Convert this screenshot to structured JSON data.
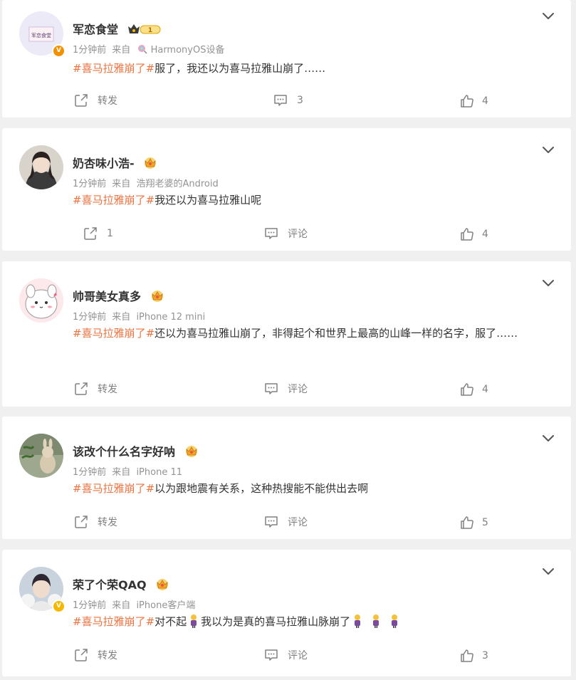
{
  "comments": [
    {
      "user": "军恋食堂",
      "verified": "orange",
      "level_badge": "1",
      "time": "1分钟前",
      "from": "来自",
      "source": "HarmonyOS设备",
      "hashtag": "#喜马拉雅崩了#",
      "text": "服了，我还以为喜马拉雅山崩了……",
      "share": "转发",
      "comment": "3",
      "likes": "4",
      "avatar_text": "军恋食堂"
    },
    {
      "user": "奶杏味小浩-",
      "verified": "",
      "time": "1分钟前",
      "from": "来自",
      "source": "浩翔老婆的Android",
      "hashtag": "#喜马拉雅崩了#",
      "text": "我还以为喜马拉雅山呢",
      "share": "1",
      "comment": "评论",
      "likes": "4"
    },
    {
      "user": "帅哥美女真多",
      "verified": "",
      "time": "1分钟前",
      "from": "来自",
      "source": "iPhone 12 mini",
      "hashtag": "#喜马拉雅崩了#",
      "text": "还以为喜马拉雅山崩了，非得起个和世界上最高的山峰一样的名字，服了……",
      "share": "转发",
      "comment": "评论",
      "likes": "4"
    },
    {
      "user": "该改个什么名字好呐",
      "verified": "",
      "time": "1分钟前",
      "from": "来自",
      "source": "iPhone 11",
      "hashtag": "#喜马拉雅崩了#",
      "text": "以为跟地震有关系，这种热搜能不能供出去啊",
      "share": "转发",
      "comment": "评论",
      "likes": "5"
    },
    {
      "user": "荣了个荣QAQ",
      "verified": "gold",
      "time": "1分钟前",
      "from": "来自",
      "source": "iPhone客户端",
      "hashtag": "#喜马拉雅崩了#",
      "text_a": "对不起",
      "text_b": "我以为是真的喜马拉雅山脉崩了",
      "share": "转发",
      "comment": "评论",
      "likes": "3"
    }
  ],
  "colors": {
    "hashtag": "#eb7340",
    "muted": "#939393",
    "verified": "#f29100"
  },
  "icons": [
    "chevron-down-icon",
    "share-icon",
    "comment-icon",
    "like-icon",
    "crown-icon",
    "verified-icon",
    "lollipop-icon",
    "emoji-icon"
  ]
}
